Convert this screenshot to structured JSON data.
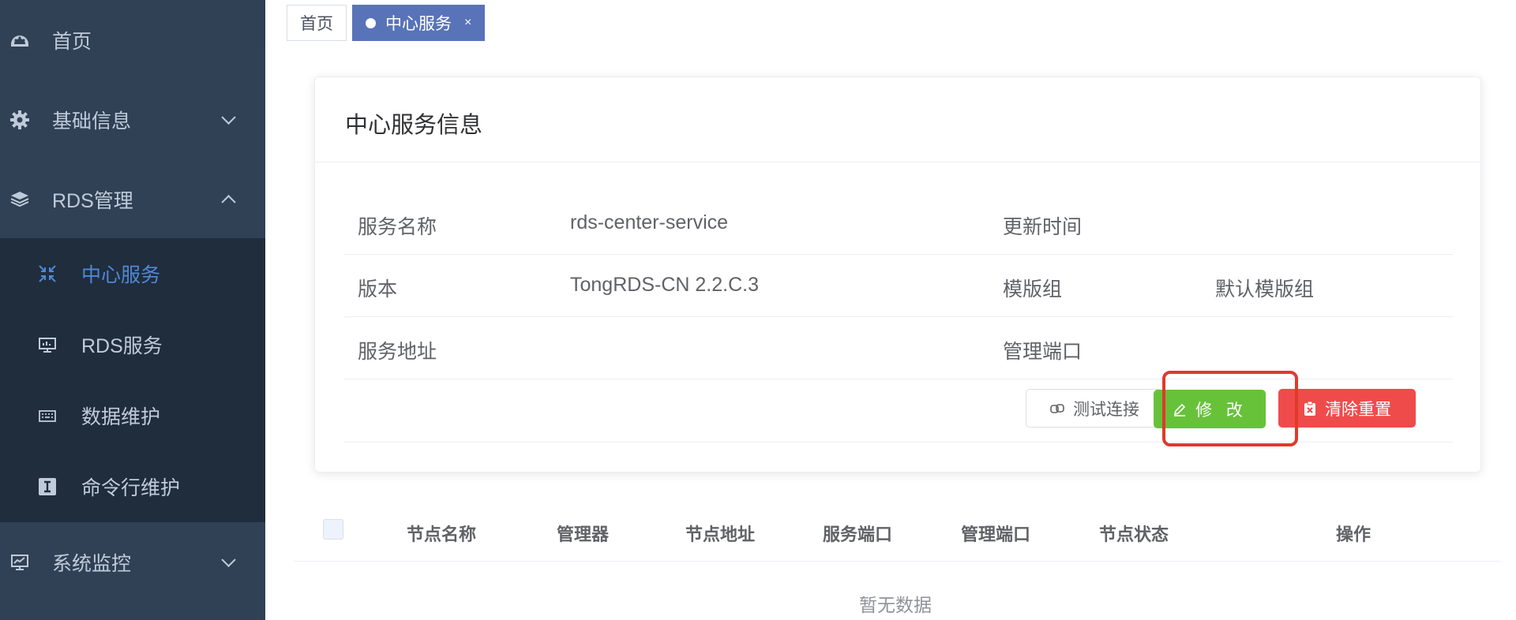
{
  "sidebar": {
    "items": [
      {
        "label": "首页",
        "icon": "dashboard-icon"
      },
      {
        "label": "基础信息",
        "icon": "gear-icon"
      },
      {
        "label": "RDS管理",
        "icon": "layers-icon"
      },
      {
        "label": "系统监控",
        "icon": "monitor-icon"
      }
    ],
    "submenu": [
      {
        "label": "中心服务",
        "icon": "compress-icon",
        "active": true
      },
      {
        "label": "RDS服务",
        "icon": "screen-icon"
      },
      {
        "label": "数据维护",
        "icon": "keyboard-icon"
      },
      {
        "label": "命令行维护",
        "icon": "text-cursor-icon"
      }
    ]
  },
  "tabs": [
    {
      "label": "首页"
    },
    {
      "label": "中心服务",
      "active": true,
      "close": "×"
    }
  ],
  "card": {
    "title": "中心服务信息",
    "rows": [
      {
        "k1": "服务名称",
        "v1": "rds-center-service",
        "k2": "更新时间",
        "v2": ""
      },
      {
        "k1": "版本",
        "v1": "TongRDS-CN 2.2.C.3",
        "k2": "模版组",
        "v2": "默认模版组"
      },
      {
        "k1": "服务地址",
        "v1": "",
        "k2": "管理端口",
        "v2": ""
      }
    ],
    "buttons": {
      "test": "测试连接",
      "edit": "修 改",
      "clear": "清除重置"
    }
  },
  "table": {
    "columns": [
      "节点名称",
      "管理器",
      "节点地址",
      "服务端口",
      "管理端口",
      "节点状态",
      "操作"
    ],
    "empty": "暂无数据"
  },
  "colors": {
    "sidebar": "#304156",
    "submenu": "#1f2d3d",
    "active": "#4f88d8",
    "edit": "#67c23a",
    "danger": "#f04b4b",
    "highlight": "#e03a2a"
  }
}
